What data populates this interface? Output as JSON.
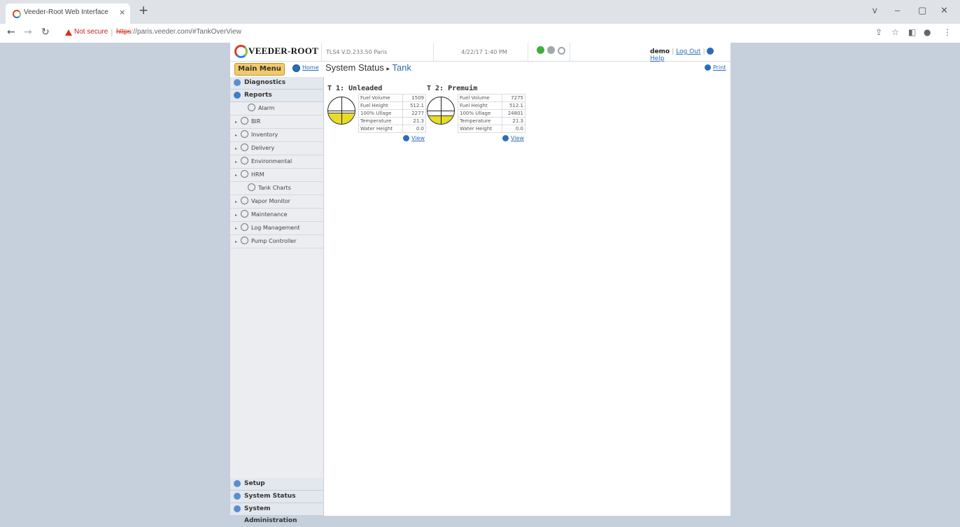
{
  "browser": {
    "tab_title": "Veeder-Root Web Interface",
    "tab_close": "×",
    "new_tab": "+",
    "not_secure": "Not secure",
    "url_scheme": "https",
    "url_rest": "://paris.veeder.com/#TankOverView",
    "window_controls": [
      "v",
      "–",
      "▢",
      "✕"
    ]
  },
  "header": {
    "logo_text": "VEEDER-ROOT",
    "system_name": "TLS4 V.D.233.50 Paris",
    "datetime": "4/22/17 1:40 PM",
    "user": "demo",
    "logout_label": "Log Out",
    "help_label": "Help"
  },
  "nav": {
    "main_menu_label": "Main Menu",
    "home_label": "Home",
    "breadcrumb_root": "System Status",
    "breadcrumb_sep": "▸",
    "breadcrumb_current": "Tank",
    "print_label": "Print"
  },
  "sidebar": {
    "diagnostics": "Diagnostics",
    "reports": "Reports",
    "items": [
      {
        "label": "Alarm",
        "expandable": false
      },
      {
        "label": "BIR",
        "expandable": true
      },
      {
        "label": "Inventory",
        "expandable": true
      },
      {
        "label": "Delivery",
        "expandable": true
      },
      {
        "label": "Environmental",
        "expandable": true
      },
      {
        "label": "HRM",
        "expandable": true
      },
      {
        "label": "Tank Charts",
        "expandable": false
      },
      {
        "label": "Vapor Monitor",
        "expandable": true
      },
      {
        "label": "Maintenance",
        "expandable": true
      },
      {
        "label": "Log Management",
        "expandable": true
      },
      {
        "label": "Pump Controller",
        "expandable": true
      }
    ],
    "bottom": {
      "setup": "Setup",
      "system_status": "System Status",
      "system_admin": "System Administration"
    }
  },
  "tanks": [
    {
      "title": "T 1: Unleaded",
      "fill_fraction": 0.4,
      "rows": [
        {
          "label": "Fuel Volume",
          "value": "1509"
        },
        {
          "label": "Fuel Height",
          "value": "512.1"
        },
        {
          "label": "100% Ullage",
          "value": "2277"
        },
        {
          "label": "Temperature",
          "value": "21.3"
        },
        {
          "label": "Water Height",
          "value": "0.0"
        }
      ],
      "view_label": "View"
    },
    {
      "title": "T 2: Premuim",
      "fill_fraction": 0.3,
      "rows": [
        {
          "label": "Fuel Volume",
          "value": "7275"
        },
        {
          "label": "Fuel Height",
          "value": "512.1"
        },
        {
          "label": "100% Ullage",
          "value": "24801"
        },
        {
          "label": "Temperature",
          "value": "21.3"
        },
        {
          "label": "Water Height",
          "value": "0.0"
        }
      ],
      "view_label": "View"
    }
  ],
  "colors": {
    "accent": "#2a6db8",
    "fuel": "#e8dc26",
    "main_menu": "#f2c96a",
    "status_ok": "#3cae3c"
  }
}
